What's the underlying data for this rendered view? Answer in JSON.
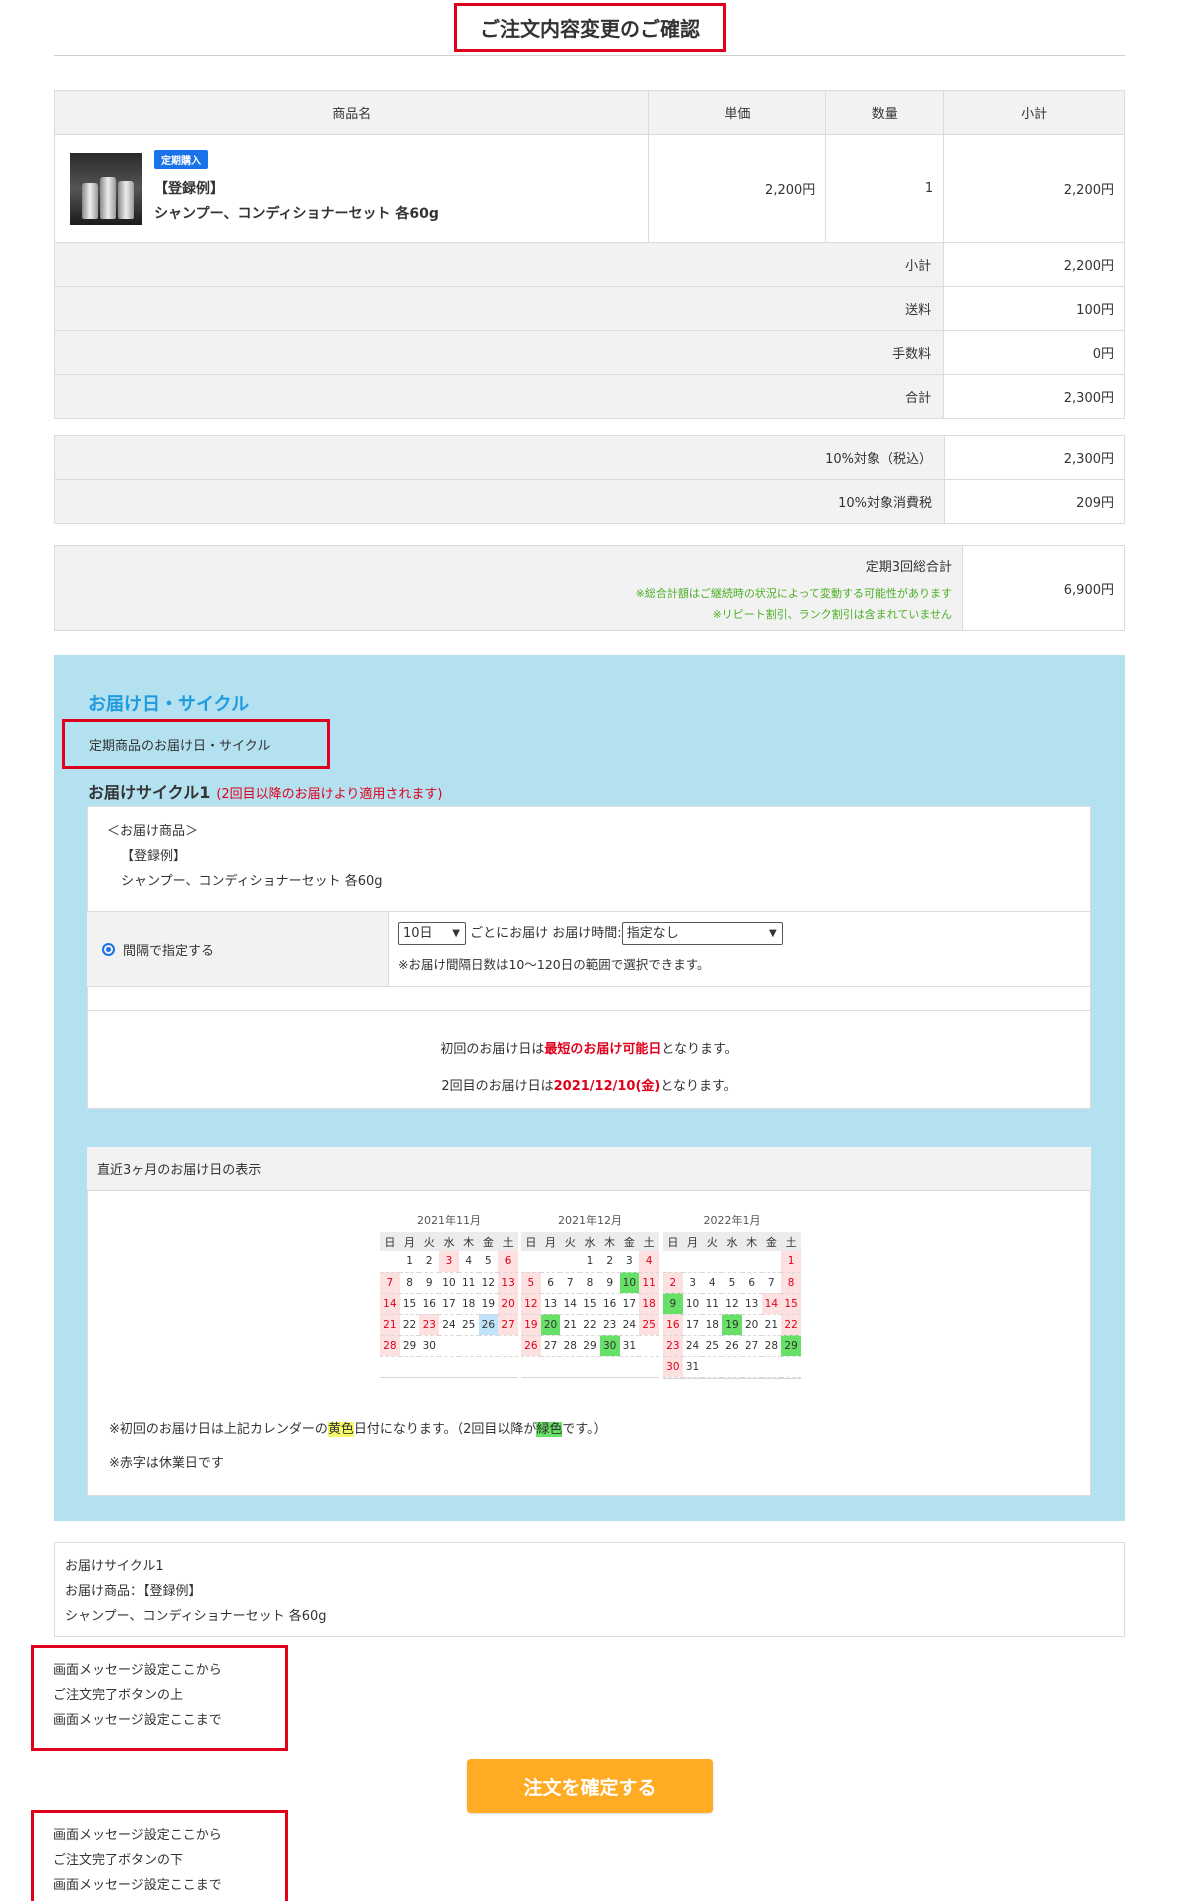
{
  "page": {
    "title": "ご注文内容変更のご確認"
  },
  "order_table": {
    "headers": {
      "name": "商品名",
      "price": "単価",
      "qty": "数量",
      "subtotal": "小計"
    },
    "item": {
      "badge": "定期購入",
      "name_line1": "【登録例】",
      "name_line2": "シャンプー、コンディショナーセット 各60g",
      "price": "2,200円",
      "qty": "1",
      "subtotal": "2,200円"
    },
    "summary": [
      {
        "label": "小計",
        "value": "2,200円"
      },
      {
        "label": "送料",
        "value": "100円"
      },
      {
        "label": "手数料",
        "value": "0円"
      },
      {
        "label": "合計",
        "value": "2,300円"
      }
    ]
  },
  "tax": [
    {
      "label": "10%対象（税込）",
      "value": "2,300円"
    },
    {
      "label": "10%対象消費税",
      "value": "209円"
    }
  ],
  "subscription_total": {
    "label": "定期3回総合計",
    "note1": "※総合計額はご継続時の状況によって変動する可能性があります",
    "note2": "※リピート割引、ランク割引は含まれていません",
    "value": "6,900円"
  },
  "delivery": {
    "section_title": "お届け日・サイクル",
    "box_note": "定期商品のお届け日・サイクル",
    "cycle_title": "お届けサイクル1",
    "cycle_note": "(2回目以降のお届けより適用されます)",
    "products_label": "＜お届け商品＞",
    "products_line1": "【登録例】",
    "products_line2": "シャンプー、コンディショナーセット 各60g",
    "interval_label": "間隔で指定する",
    "interval_value": "10日",
    "interval_suffix": "ごとにお届け",
    "time_label": "お届け時間:",
    "time_value": "指定なし",
    "interval_hint": "※お届け間隔日数は10〜120日の範囲で選択できます。",
    "first_pre": "初回のお届け日は",
    "first_em": "最短のお届け可能日",
    "first_post": "となります。",
    "second_pre": "2回目のお届け日は",
    "second_em": "2021/12/10(金)",
    "second_post": "となります。"
  },
  "calendar": {
    "heading": "直近3ヶ月のお届け日の表示",
    "weekdays": [
      "日",
      "月",
      "火",
      "水",
      "木",
      "金",
      "土"
    ],
    "months": [
      {
        "caption": "2021年11月",
        "weeks": [
          [
            "",
            "1",
            "2",
            "3",
            "4",
            "5",
            "6"
          ],
          [
            "7",
            "8",
            "9",
            "10",
            "11",
            "12",
            "13"
          ],
          [
            "14",
            "15",
            "16",
            "17",
            "18",
            "19",
            "20"
          ],
          [
            "21",
            "22",
            "23",
            "24",
            "25",
            "26",
            "27"
          ],
          [
            "28",
            "29",
            "30",
            "",
            "",
            "",
            ""
          ]
        ],
        "holidays": [
          "3",
          "6",
          "7",
          "13",
          "14",
          "20",
          "21",
          "23",
          "27",
          "28"
        ],
        "green": [],
        "blue": [
          "26"
        ]
      },
      {
        "caption": "2021年12月",
        "weeks": [
          [
            "",
            "",
            "",
            "1",
            "2",
            "3",
            "4"
          ],
          [
            "5",
            "6",
            "7",
            "8",
            "9",
            "10",
            "11"
          ],
          [
            "12",
            "13",
            "14",
            "15",
            "16",
            "17",
            "18"
          ],
          [
            "19",
            "20",
            "21",
            "22",
            "23",
            "24",
            "25"
          ],
          [
            "26",
            "27",
            "28",
            "29",
            "30",
            "31",
            ""
          ]
        ],
        "holidays": [
          "4",
          "5",
          "11",
          "12",
          "18",
          "19",
          "25",
          "26"
        ],
        "green": [
          "10",
          "20",
          "30"
        ],
        "blue": []
      },
      {
        "caption": "2022年1月",
        "weeks": [
          [
            "",
            "",
            "",
            "",
            "",
            "",
            "1"
          ],
          [
            "2",
            "3",
            "4",
            "5",
            "6",
            "7",
            "8"
          ],
          [
            "9",
            "10",
            "11",
            "12",
            "13",
            "14",
            "15"
          ],
          [
            "16",
            "17",
            "18",
            "19",
            "20",
            "21",
            "22"
          ],
          [
            "23",
            "24",
            "25",
            "26",
            "27",
            "28",
            "29"
          ],
          [
            "30",
            "31",
            "",
            "",
            "",
            "",
            ""
          ]
        ],
        "holidays": [
          "1",
          "2",
          "8",
          "14",
          "15",
          "16",
          "22",
          "23",
          "30"
        ],
        "green": [
          "9",
          "19",
          "29"
        ],
        "blue": []
      }
    ],
    "note1_pre": "※初回のお届け日は上記カレンダーの",
    "note1_yellow": "黄色",
    "note1_mid": "日付になります。（2回目以降が",
    "note1_green": "緑色",
    "note1_post": "です。）",
    "note2": "※赤字は休業日です"
  },
  "summary_box": {
    "line1": "お届けサイクル1",
    "line2": "お届け商品：【登録例】",
    "line3": "シャンプー、コンディショナーセット 各60g"
  },
  "message_top": {
    "line1": "画面メッセージ設定ここから",
    "line2": "ご注文完了ボタンの上",
    "line3": "画面メッセージ設定ここまで"
  },
  "confirm_button": {
    "label": "注文を確定する"
  },
  "message_bottom": {
    "line1": "画面メッセージ設定ここから",
    "line2": "ご注文完了ボタンの下",
    "line3": "画面メッセージ設定ここまで"
  }
}
